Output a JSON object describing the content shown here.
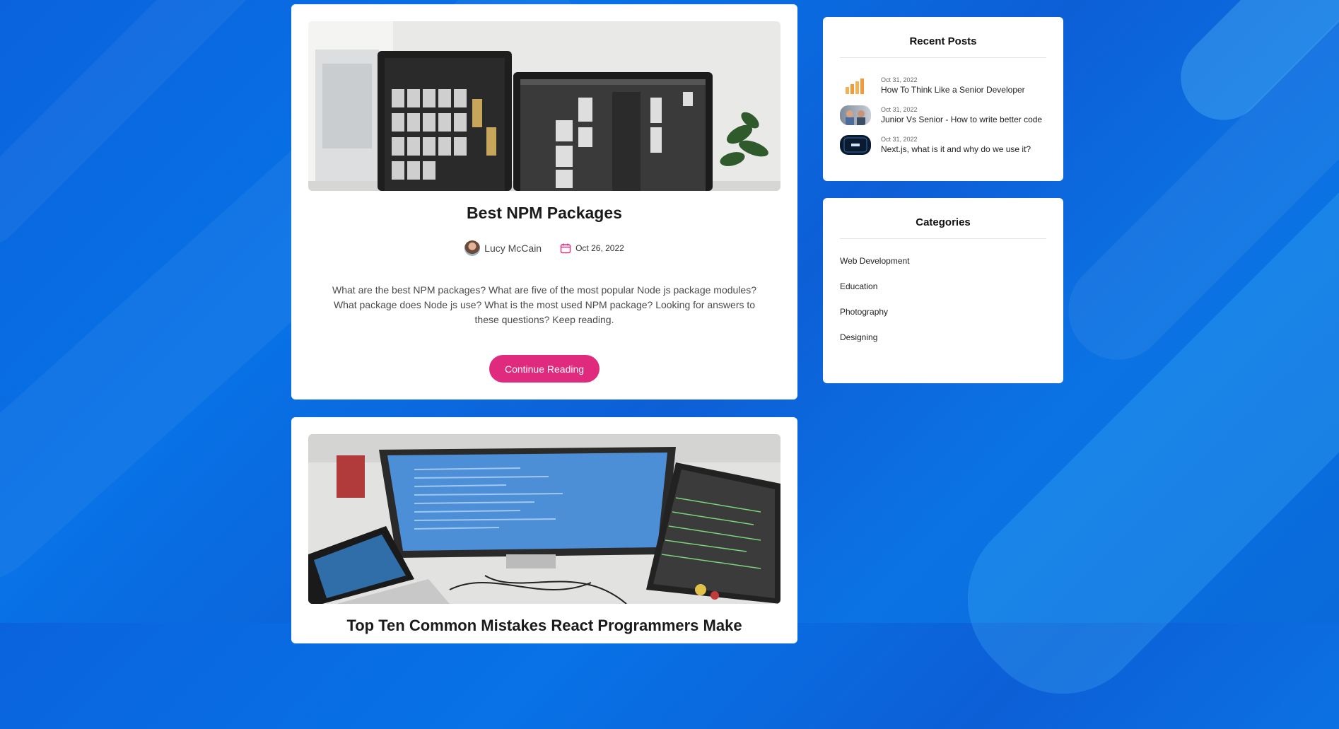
{
  "colors": {
    "accent": "#df2a7d",
    "background": "#0a66de",
    "card": "#ffffff"
  },
  "posts": [
    {
      "title": "Best NPM Packages",
      "author": "Lucy McCain",
      "date": "Oct 26, 2022",
      "excerpt": "What are the best NPM packages? What are five of the most popular Node js package modules? What package does Node js use? What is the most used NPM package? Looking for answers to these questions? Keep reading.",
      "cta_label": "Continue Reading",
      "icons": [
        "author-avatar",
        "calendar-icon"
      ]
    },
    {
      "title": "Top Ten Common Mistakes React Programmers Make"
    }
  ],
  "sidebar": {
    "recent_posts": {
      "title": "Recent Posts",
      "items": [
        {
          "date": "Oct 31, 2022",
          "title": "How To Think Like a Senior Developer"
        },
        {
          "date": "Oct 31, 2022",
          "title": "Junior Vs Senior - How to write better code"
        },
        {
          "date": "Oct 31, 2022",
          "title": "Next.js, what is it and why do we use it?"
        }
      ]
    },
    "categories": {
      "title": "Categories",
      "items": [
        "Web Development",
        "Education",
        "Photography",
        "Designing"
      ]
    }
  }
}
